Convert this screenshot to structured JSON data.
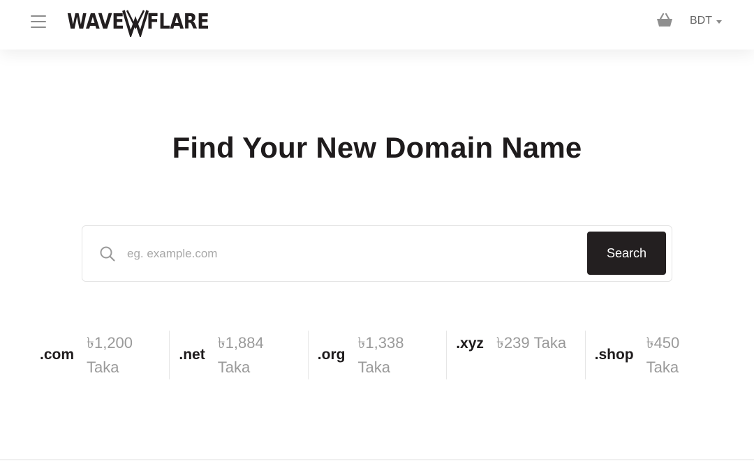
{
  "header": {
    "logo_left": "WAVE",
    "logo_right": "FLARE",
    "currency": "BDT",
    "icons": {
      "menu": "hamburger-menu-icon",
      "cart": "shopping-basket-icon",
      "currency_caret": "caret-down-icon"
    }
  },
  "hero": {
    "title": "Find Your New Domain Name"
  },
  "search": {
    "placeholder": "eg. example.com",
    "value": "",
    "button_label": "Search",
    "icon": "search-icon"
  },
  "tlds": [
    {
      "ext": ".com",
      "price": "৳1,200 Taka"
    },
    {
      "ext": ".net",
      "price": "৳1,884 Taka"
    },
    {
      "ext": ".org",
      "price": "৳1,338 Taka"
    },
    {
      "ext": ".xyz",
      "price": "৳239 Taka"
    },
    {
      "ext": ".shop",
      "price": "৳450 Taka"
    }
  ],
  "colors": {
    "brand_dark": "#231f20",
    "muted_text": "#9a9a9a",
    "border": "#e4e4e4"
  }
}
